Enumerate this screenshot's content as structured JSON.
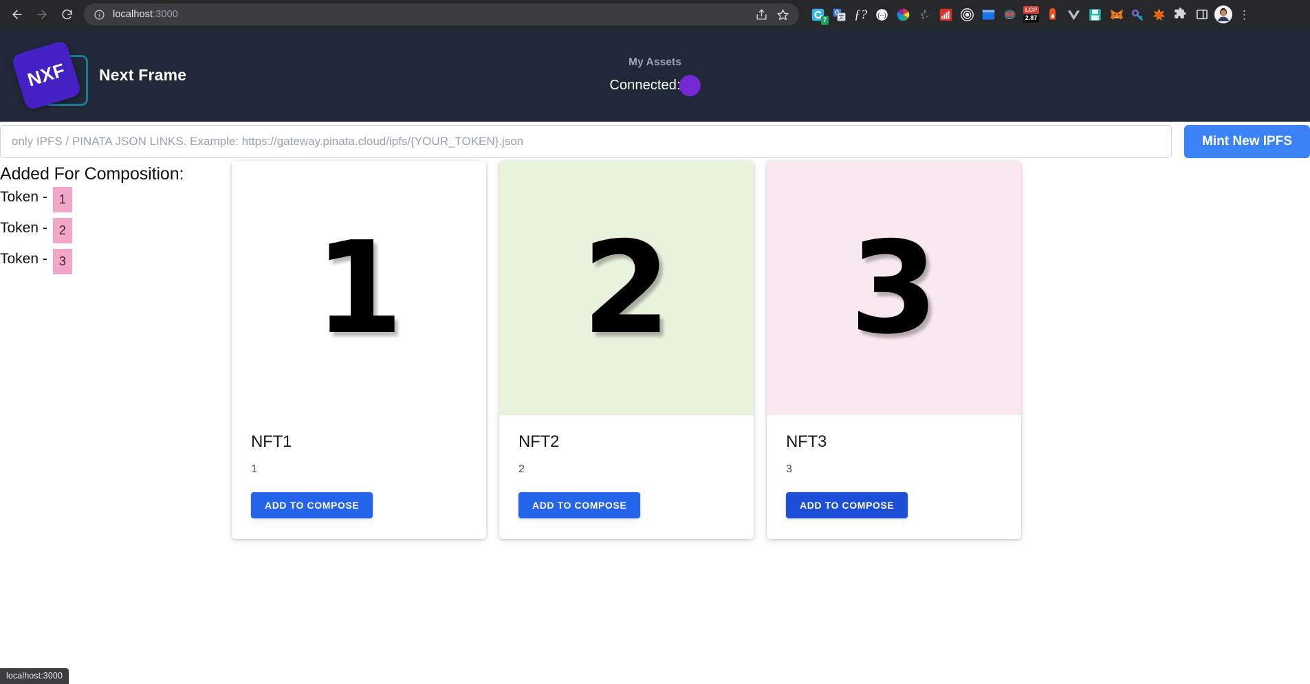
{
  "browser": {
    "back_label": "Back",
    "forward_label": "Forward",
    "reload_label": "Reload",
    "url_main": "localhost",
    "url_suffix": ":3000",
    "site_info_icon": "info-circle-icon",
    "share_icon": "share-icon",
    "bookmark_icon": "star-icon",
    "menu_icon": "kebab-menu-icon",
    "extensions": [
      {
        "name": "clipboard-extension-icon",
        "badge": "7"
      },
      {
        "name": "google-translate-icon",
        "badge": ""
      },
      {
        "name": "fonts-ninja-icon",
        "badge": ""
      },
      {
        "name": "wappalyzer-icon",
        "badge": ""
      },
      {
        "name": "colorzilla-icon",
        "badge": ""
      },
      {
        "name": "recycle-icon",
        "badge": ""
      },
      {
        "name": "analytics-icon",
        "badge": ""
      },
      {
        "name": "target-icon",
        "badge": ""
      },
      {
        "name": "window-resizer-icon",
        "badge": ""
      },
      {
        "name": "goggles-icon",
        "badge": ""
      },
      {
        "name": "lcp-web-vitals-icon",
        "badge": "2.87"
      },
      {
        "name": "hydrant-icon",
        "badge": ""
      },
      {
        "name": "vue-devtools-icon",
        "badge": ""
      },
      {
        "name": "save-page-icon",
        "badge": ""
      },
      {
        "name": "metamask-fox-icon",
        "badge": ""
      },
      {
        "name": "password-key-icon",
        "badge": ""
      },
      {
        "name": "spark-icon",
        "badge": ""
      },
      {
        "name": "puzzle-extensions-icon",
        "badge": ""
      },
      {
        "name": "sidebar-icon",
        "badge": ""
      }
    ],
    "lcp_label_top": "LCP",
    "lcp_label_bottom": "2.87",
    "profile_icon": "user-avatar"
  },
  "status_bar": {
    "text": "localhost:3000"
  },
  "header": {
    "logo_text": "NXF",
    "brand_name": "Next Frame",
    "my_assets_label": "My Assets",
    "connected_label": "Connected:",
    "wallet_color": "#7528d4",
    "background_color": "#1f2937"
  },
  "mint": {
    "input_value": "",
    "input_placeholder": "only IPFS / PINATA JSON LINKS. Example: https://gateway.pinata.cloud/ipfs/{YOUR_TOKEN}.json",
    "button_label": "Mint New IPFS",
    "button_color": "#3b82f6"
  },
  "composition": {
    "title": "Added For Composition:",
    "badge_color": "#f4a6c8",
    "tokens": [
      {
        "label": "Token - ",
        "id": "1"
      },
      {
        "label": "Token - ",
        "id": "2"
      },
      {
        "label": "Token - ",
        "id": "3"
      }
    ]
  },
  "cards": [
    {
      "numeral": "1",
      "media_bg": "#ffffff",
      "title": "NFT1",
      "description": "1",
      "button_label": "ADD TO COMPOSE",
      "button_color": "#2563eb"
    },
    {
      "numeral": "2",
      "media_bg": "#e8f2dc",
      "title": "NFT2",
      "description": "2",
      "button_label": "ADD TO COMPOSE",
      "button_color": "#2563eb"
    },
    {
      "numeral": "3",
      "media_bg": "#fae8f1",
      "title": "NFT3",
      "description": "3",
      "button_label": "ADD TO COMPOSE",
      "button_color": "#1d4ed8"
    }
  ]
}
